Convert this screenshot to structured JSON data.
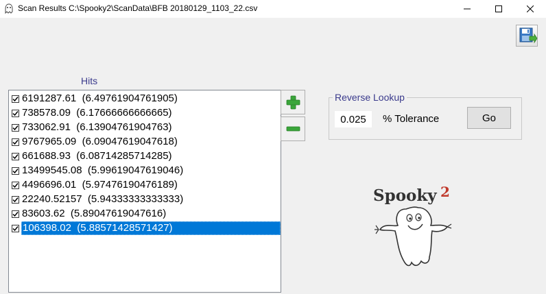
{
  "window": {
    "title": "Scan Results C:\\Spooky2\\ScanData\\BFB 20180129_1103_22.csv",
    "icons": {
      "app": "spooky-app-icon",
      "minimize": "minimize-icon",
      "maximize": "maximize-icon",
      "close": "close-icon"
    }
  },
  "toolbar": {
    "save_icon": "save-icon"
  },
  "hits": {
    "label": "Hits",
    "items": [
      {
        "text": "6191287.61  (6.49761904761905)",
        "checked": true,
        "selected": false
      },
      {
        "text": "738578.09  (6.17666666666665)",
        "checked": true,
        "selected": false
      },
      {
        "text": "733062.91  (6.13904761904763)",
        "checked": true,
        "selected": false
      },
      {
        "text": "9767965.09  (6.09047619047618)",
        "checked": true,
        "selected": false
      },
      {
        "text": "661688.93  (6.08714285714285)",
        "checked": true,
        "selected": false
      },
      {
        "text": "13499545.08  (5.99619047619046)",
        "checked": true,
        "selected": false
      },
      {
        "text": "4496696.01  (5.97476190476189)",
        "checked": true,
        "selected": false
      },
      {
        "text": "22240.52157  (5.94333333333333)",
        "checked": true,
        "selected": false
      },
      {
        "text": "83603.62  (5.89047619047616)",
        "checked": true,
        "selected": false
      },
      {
        "text": "106398.02  (5.88571428571427)",
        "checked": true,
        "selected": true
      }
    ],
    "add_icon": "plus-icon",
    "remove_icon": "minus-icon",
    "add_color": "#3aa53a",
    "remove_color": "#3aa53a"
  },
  "reverse_lookup": {
    "legend": "Reverse Lookup",
    "tolerance_value": "0.025",
    "tolerance_label": "% Tolerance",
    "go_label": "Go"
  },
  "logo": {
    "text": "Spooky",
    "superscript": "2",
    "accent": "#c0392b"
  },
  "colors": {
    "selection": "#0078d7",
    "group_label": "#3a3a8c"
  }
}
